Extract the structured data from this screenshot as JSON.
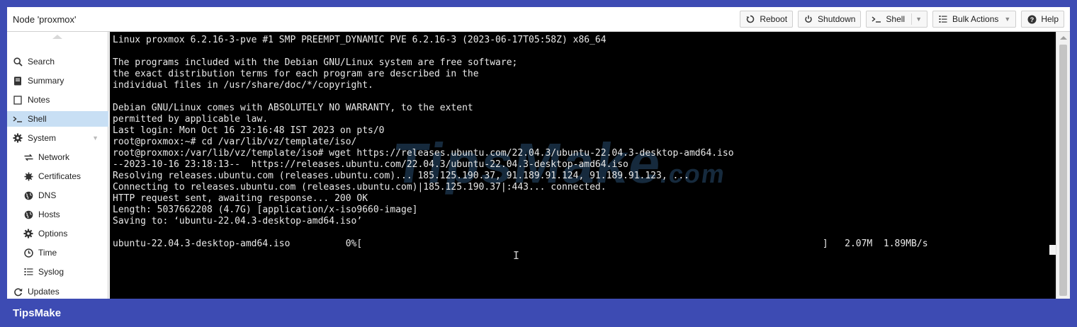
{
  "header": {
    "title": "Node 'proxmox'",
    "buttons": {
      "reboot": "Reboot",
      "shutdown": "Shutdown",
      "shell": "Shell",
      "bulk_actions": "Bulk Actions",
      "help": "Help"
    }
  },
  "sidebar": {
    "items": [
      {
        "label": "Search",
        "icon": "search-icon"
      },
      {
        "label": "Summary",
        "icon": "book-icon"
      },
      {
        "label": "Notes",
        "icon": "note-icon"
      },
      {
        "label": "Shell",
        "icon": "terminal-icon",
        "active": true
      },
      {
        "label": "System",
        "icon": "gear-icon"
      },
      {
        "label": "Network",
        "icon": "network-icon"
      },
      {
        "label": "Certificates",
        "icon": "certificate-icon"
      },
      {
        "label": "DNS",
        "icon": "globe-icon"
      },
      {
        "label": "Hosts",
        "icon": "globe-icon"
      },
      {
        "label": "Options",
        "icon": "gear-icon"
      },
      {
        "label": "Time",
        "icon": "clock-icon"
      },
      {
        "label": "Syslog",
        "icon": "list-icon"
      },
      {
        "label": "Updates",
        "icon": "refresh-icon"
      }
    ]
  },
  "terminal": {
    "lines": [
      "Linux proxmox 6.2.16-3-pve #1 SMP PREEMPT_DYNAMIC PVE 6.2.16-3 (2023-06-17T05:58Z) x86_64",
      "",
      "The programs included with the Debian GNU/Linux system are free software;",
      "the exact distribution terms for each program are described in the",
      "individual files in /usr/share/doc/*/copyright.",
      "",
      "Debian GNU/Linux comes with ABSOLUTELY NO WARRANTY, to the extent",
      "permitted by applicable law.",
      "Last login: Mon Oct 16 23:16:48 IST 2023 on pts/0",
      "root@proxmox:~# cd /var/lib/vz/template/iso/",
      "root@proxmox:/var/lib/vz/template/iso# wget https://releases.ubuntu.com/22.04.3/ubuntu-22.04.3-desktop-amd64.iso",
      "--2023-10-16 23:18:13--  https://releases.ubuntu.com/22.04.3/ubuntu-22.04.3-desktop-amd64.iso",
      "Resolving releases.ubuntu.com (releases.ubuntu.com)... 185.125.190.37, 91.189.91.124, 91.189.91.123, ...",
      "Connecting to releases.ubuntu.com (releases.ubuntu.com)|185.125.190.37|:443... connected.",
      "HTTP request sent, awaiting response... 200 OK",
      "Length: 5037662208 (4.7G) [application/x-iso9660-image]",
      "Saving to: ‘ubuntu-22.04.3-desktop-amd64.iso’",
      "",
      "ubuntu-22.04.3-desktop-amd64.iso          0%[                                                                                   ]   2.07M  1.89MB/s"
    ]
  },
  "watermark": {
    "main": "TipsMake",
    "suffix": ".com"
  },
  "footer": {
    "brand": "TipsMake"
  }
}
